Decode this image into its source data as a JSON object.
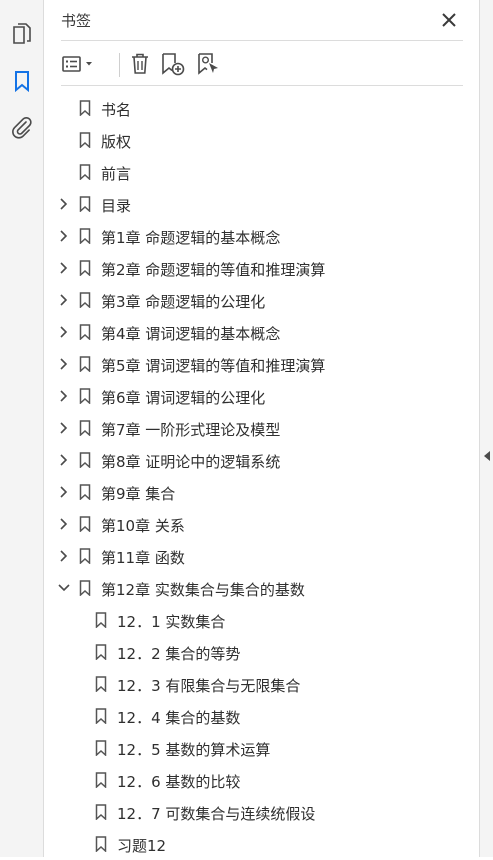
{
  "panel": {
    "title": "书签"
  },
  "colors": {
    "accent": "#1473e6",
    "icon": "#4b4b4b"
  },
  "leftbar": {
    "icons": [
      "pages-icon",
      "bookmark-icon",
      "attachment-icon"
    ]
  },
  "toolbar": {
    "icons": [
      "options-menu-icon",
      "delete-icon",
      "new-bookmark-icon",
      "bookmark-from-selection-icon"
    ]
  },
  "bookmarks": [
    {
      "label": "书名",
      "level": 0,
      "expand": "none"
    },
    {
      "label": "版权",
      "level": 0,
      "expand": "none"
    },
    {
      "label": "前言",
      "level": 0,
      "expand": "none"
    },
    {
      "label": "目录",
      "level": 0,
      "expand": "collapsed"
    },
    {
      "label": "第1章 命题逻辑的基本概念",
      "level": 0,
      "expand": "collapsed"
    },
    {
      "label": "第2章 命题逻辑的等值和推理演算",
      "level": 0,
      "expand": "collapsed"
    },
    {
      "label": "第3章 命题逻辑的公理化",
      "level": 0,
      "expand": "collapsed"
    },
    {
      "label": "第4章 谓词逻辑的基本概念",
      "level": 0,
      "expand": "collapsed"
    },
    {
      "label": "第5章 谓词逻辑的等值和推理演算",
      "level": 0,
      "expand": "collapsed"
    },
    {
      "label": "第6章 谓词逻辑的公理化",
      "level": 0,
      "expand": "collapsed"
    },
    {
      "label": "第7章 一阶形式理论及模型",
      "level": 0,
      "expand": "collapsed"
    },
    {
      "label": "第8章 证明论中的逻辑系统",
      "level": 0,
      "expand": "collapsed"
    },
    {
      "label": "第9章 集合",
      "level": 0,
      "expand": "collapsed"
    },
    {
      "label": "第10章 关系",
      "level": 0,
      "expand": "collapsed"
    },
    {
      "label": "第11章 函数",
      "level": 0,
      "expand": "collapsed"
    },
    {
      "label": "第12章 实数集合与集合的基数",
      "level": 0,
      "expand": "expanded"
    },
    {
      "label": "12．1 实数集合",
      "level": 1,
      "expand": "none"
    },
    {
      "label": "12．2 集合的等势",
      "level": 1,
      "expand": "none"
    },
    {
      "label": "12．3 有限集合与无限集合",
      "level": 1,
      "expand": "none"
    },
    {
      "label": "12．4 集合的基数",
      "level": 1,
      "expand": "none"
    },
    {
      "label": "12．5 基数的算术运算",
      "level": 1,
      "expand": "none"
    },
    {
      "label": "12．6 基数的比较",
      "level": 1,
      "expand": "none"
    },
    {
      "label": "12．7 可数集合与连续统假设",
      "level": 1,
      "expand": "none"
    },
    {
      "label": "习题12",
      "level": 1,
      "expand": "none"
    }
  ]
}
